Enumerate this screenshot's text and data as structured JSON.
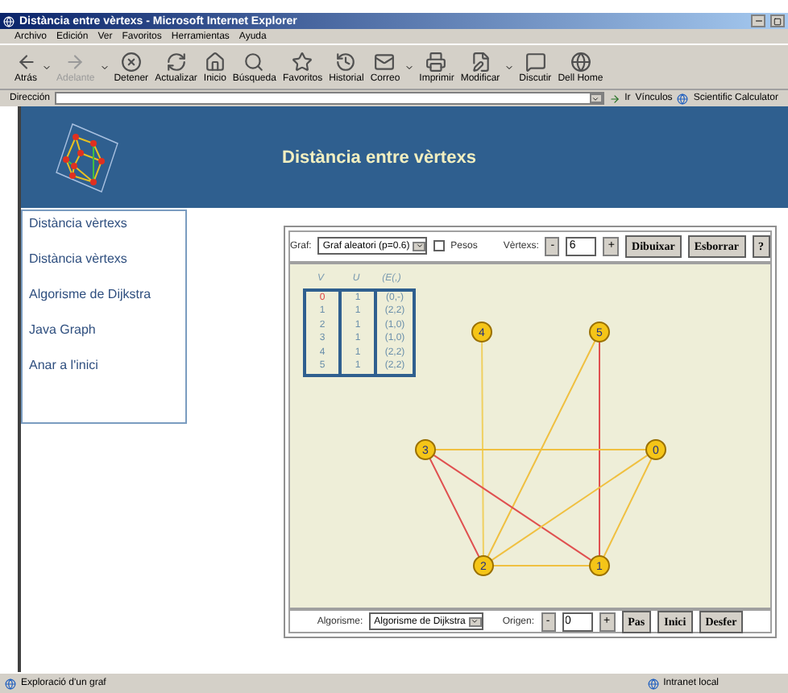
{
  "window": {
    "title": "Distància entre vèrtexs - Microsoft Internet Explorer"
  },
  "menu": [
    "Archivo",
    "Edición",
    "Ver",
    "Favoritos",
    "Herramientas",
    "Ayuda"
  ],
  "toolbar": [
    {
      "label": "Atrás",
      "disabled": false,
      "dropdown": true
    },
    {
      "label": "Adelante",
      "disabled": true,
      "dropdown": true
    },
    {
      "label": "Detener",
      "disabled": false,
      "dropdown": false
    },
    {
      "label": "Actualizar",
      "disabled": false,
      "dropdown": false
    },
    {
      "label": "Inicio",
      "disabled": false,
      "dropdown": false
    },
    {
      "label": "Búsqueda",
      "disabled": false,
      "dropdown": false
    },
    {
      "label": "Favoritos",
      "disabled": false,
      "dropdown": false
    },
    {
      "label": "Historial",
      "disabled": false,
      "dropdown": false
    },
    {
      "label": "Correo",
      "disabled": false,
      "dropdown": true
    },
    {
      "label": "Imprimir",
      "disabled": false,
      "dropdown": false
    },
    {
      "label": "Modificar",
      "disabled": false,
      "dropdown": true
    },
    {
      "label": "Discutir",
      "disabled": false,
      "dropdown": false
    },
    {
      "label": "Dell Home",
      "disabled": false,
      "dropdown": false
    }
  ],
  "address_bar": {
    "label": "Dirección",
    "go": "Ir",
    "links_label": "Vínculos",
    "link": "Scientific Calculator"
  },
  "page": {
    "title": "Distància entre vèrtexs",
    "sidebar": [
      "Distància vèrtexs",
      "Distància vèrtexs",
      "Algorisme de Dijkstra",
      "Java Graph",
      "Anar a l'inici"
    ]
  },
  "applet": {
    "graph_label": "Graf:",
    "graph_type": "Graf aleatori (p=0.6)",
    "weights": {
      "label": "Pesos",
      "checked": false
    },
    "vertices_label": "Vèrtexs:",
    "minus": "-",
    "vertices": "6",
    "plus": "+",
    "buttons": [
      "Dibuixar",
      "Esborrar",
      "?"
    ],
    "table": {
      "columns": [
        "V",
        "U",
        "(E(,)"
      ],
      "rows": [
        {
          "v": "0",
          "u": "1",
          "e": "(0,-)",
          "current": true
        },
        {
          "v": "1",
          "u": "1",
          "e": "(2,2)",
          "current": false
        },
        {
          "v": "2",
          "u": "1",
          "e": "(1,0)",
          "current": false
        },
        {
          "v": "3",
          "u": "1",
          "e": "(1,0)",
          "current": false
        },
        {
          "v": "4",
          "u": "1",
          "e": "(2,2)",
          "current": false
        },
        {
          "v": "5",
          "u": "1",
          "e": "(2,2)",
          "current": false
        }
      ]
    },
    "graph": {
      "nodes": [
        "0",
        "1",
        "2",
        "3",
        "4",
        "5"
      ],
      "edges": [
        {
          "color": "#f0d060"
        },
        {
          "color": "#e05050"
        },
        {
          "color": "#f0c040"
        },
        {
          "color": "#f0c040"
        },
        {
          "color": "#e05050"
        },
        {
          "color": "#e05050"
        },
        {
          "color": "#f0c040"
        },
        {
          "color": "#f0c040"
        },
        {
          "color": "#f0c040"
        }
      ]
    },
    "algorithm_label": "Algorisme:",
    "algorithm": "Algorisme de Dijkstra",
    "origin_label": "Origen:",
    "origin_minus": "-",
    "origin": "0",
    "origin_plus": "+",
    "steps": [
      "Pas",
      "Inici",
      "Desfer"
    ]
  },
  "status_bar": {
    "text": "Exploració d'un graf",
    "zone": "Intranet local"
  }
}
